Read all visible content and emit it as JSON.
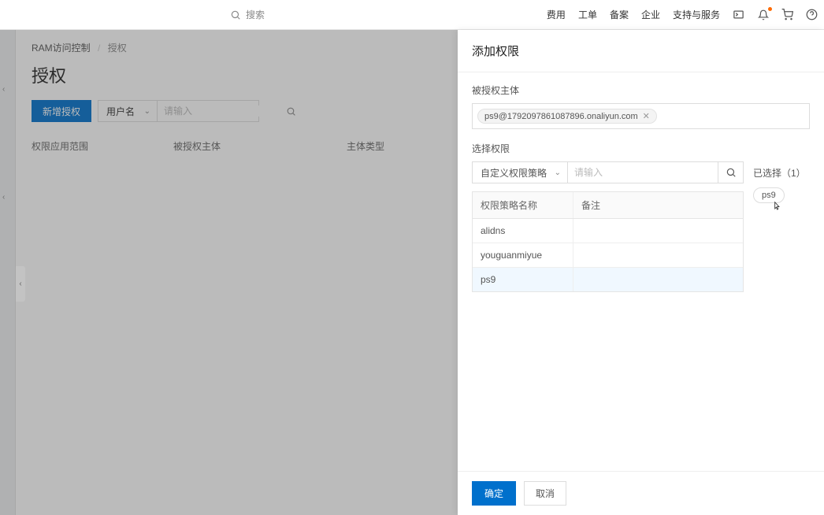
{
  "topnav": {
    "search_placeholder": "搜索",
    "items": [
      "费用",
      "工单",
      "备案",
      "企业",
      "支持与服务"
    ]
  },
  "breadcrumb": {
    "root": "RAM访问控制",
    "current": "授权"
  },
  "page": {
    "title": "授权",
    "new_btn": "新增授权",
    "filter_select": "用户名",
    "search_placeholder": "请输入"
  },
  "table": {
    "col1": "权限应用范围",
    "col2": "被授权主体",
    "col3": "主体类型"
  },
  "drawer": {
    "title": "添加权限",
    "principal_label": "被授权主体",
    "principal_tag": "ps9@1792097861087896.onaliyun.com",
    "select_perm_label": "选择权限",
    "perm_type": "自定义权限策略",
    "perm_search_placeholder": "请输入",
    "th_name": "权限策略名称",
    "th_remark": "备注",
    "rows": [
      {
        "name": "alidns",
        "remark": ""
      },
      {
        "name": "youguanmiyue",
        "remark": ""
      },
      {
        "name": "ps9",
        "remark": ""
      }
    ],
    "selected_label": "已选择（1）",
    "selected_tag": "ps9",
    "ok": "确定",
    "cancel": "取消"
  }
}
